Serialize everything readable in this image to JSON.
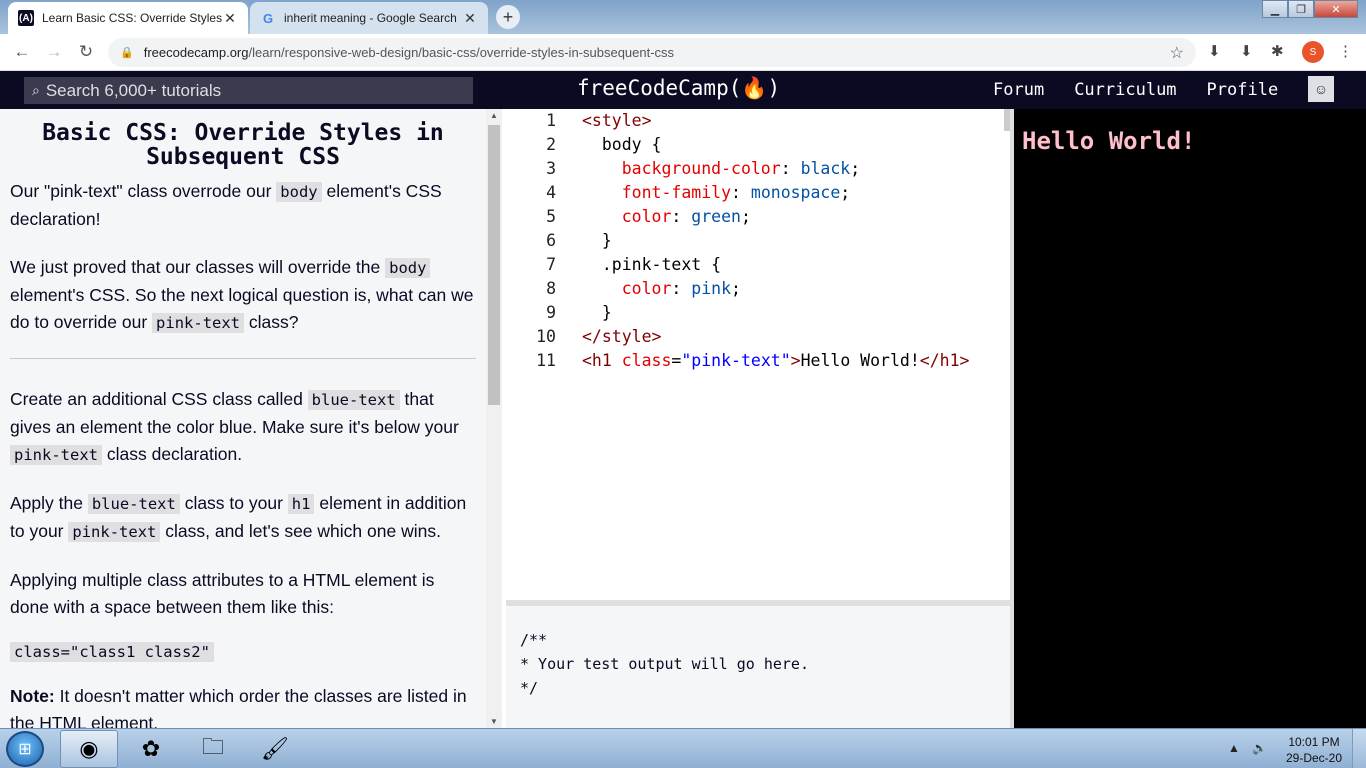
{
  "browser": {
    "tabs": [
      {
        "title": "Learn Basic CSS: Override Styles in",
        "favicon": "freecodecamp-icon",
        "active": true
      },
      {
        "title": "inherit meaning - Google Search",
        "favicon": "google-icon",
        "active": false
      }
    ],
    "newtab_label": "+",
    "url_host": "freecodecamp.org",
    "url_path": "/learn/responsive-web-design/basic-css/override-styles-in-subsequent-css",
    "profile_initial": "S"
  },
  "nav": {
    "search_placeholder": "Search 6,000+ tutorials",
    "brand": "freeCodeCamp(🔥)",
    "links": [
      "Forum",
      "Curriculum",
      "Profile"
    ]
  },
  "lesson": {
    "title": "Basic CSS: Override Styles in Subsequent CSS",
    "p1_a": "Our \"pink-text\" class overrode our ",
    "p1_code": "body",
    "p1_b": " element's CSS declaration!",
    "p2_a": "We just proved that our classes will override the ",
    "p2_code1": "body",
    "p2_b": " element's CSS. So the next logical question is, what can we do to override our ",
    "p2_code2": "pink-text",
    "p2_c": " class?",
    "p3_a": "Create an additional CSS class called ",
    "p3_code1": "blue-text",
    "p3_b": " that gives an element the color blue. Make sure it's below your ",
    "p3_code2": "pink-text",
    "p3_c": " class declaration.",
    "p4_a": "Apply the ",
    "p4_code1": "blue-text",
    "p4_b": " class to your ",
    "p4_code2": "h1",
    "p4_c": " element in addition to your ",
    "p4_code3": "pink-text",
    "p4_d": " class, and let's see which one wins.",
    "p5": "Applying multiple class attributes to a HTML element is done with a space between them like this:",
    "codeblock": "class=\"class1 class2\"",
    "note_label": "Note:",
    "note_text": " It doesn't matter which order the classes are listed in the HTML element."
  },
  "editor": {
    "line_numbers": [
      "1",
      "2",
      "3",
      "4",
      "5",
      "6",
      "7",
      "8",
      "9",
      "10",
      "11"
    ],
    "test_output": "/**\n* Your test output will go here.\n*/"
  },
  "preview": {
    "heading": "Hello World!",
    "background": "#000000",
    "heading_color": "#ffc0cb"
  },
  "taskbar": {
    "time": "10:01 PM",
    "date": "29-Dec-20",
    "apps": [
      "chrome-icon",
      "app-icon",
      "file-explorer-icon",
      "paint-icon"
    ]
  },
  "colors": {
    "fcc_nav": "#0a0a23",
    "instructions_bg": "#f5f6f7",
    "code_bg": "#dfdfe2"
  }
}
